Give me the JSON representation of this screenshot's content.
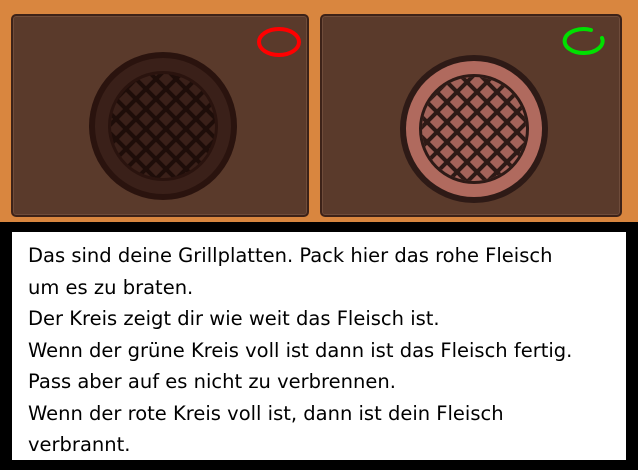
{
  "grills": [
    {
      "id": "left",
      "state": "raw",
      "plate_color": "#3a2019",
      "timer_color": "#ff0000",
      "timer_progress": 1.0
    },
    {
      "id": "right",
      "state": "cooking",
      "plate_color": "#b06a5e",
      "timer_color": "#00e000",
      "timer_progress": 0.75
    }
  ],
  "dialog": {
    "lines": [
      "Das sind deine Grillplatten. Pack hier das rohe Fleisch",
      "um es zu braten.",
      "Der Kreis zeigt dir wie weit das Fleisch ist.",
      "Wenn der grüne Kreis voll ist dann ist das Fleisch fertig.",
      "Pass aber auf es nicht zu verbrennen.",
      "Wenn der rote Kreis voll ist, dann ist dein Fleisch",
      "verbrannt."
    ]
  }
}
